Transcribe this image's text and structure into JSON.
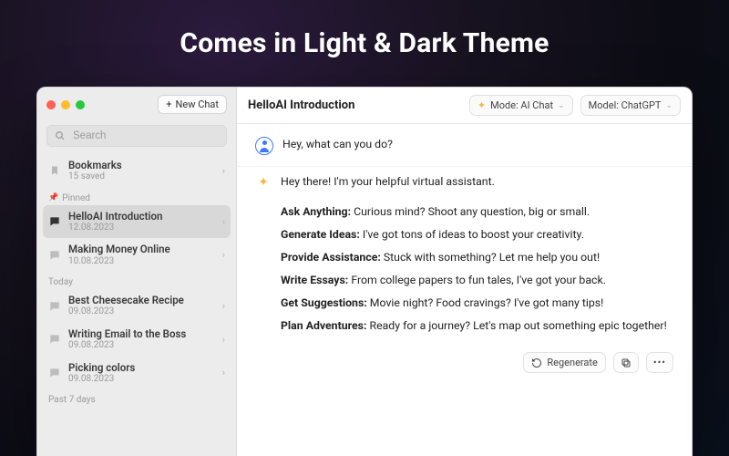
{
  "hero": {
    "headline": "Comes in Light & Dark Theme"
  },
  "sidebar": {
    "new_chat_label": "New Chat",
    "search_placeholder": "Search",
    "bookmarks": {
      "title": "Bookmarks",
      "subtitle": "15 saved"
    },
    "pinned_label": "Pinned",
    "today_label": "Today",
    "past7_label": "Past 7 days",
    "pinned": [
      {
        "title": "HelloAI Introduction",
        "date": "12.08.2023",
        "selected": true
      },
      {
        "title": "Making Money Online",
        "date": "10.08.2023",
        "selected": false
      }
    ],
    "today": [
      {
        "title": "Best Cheesecake Recipe",
        "date": "09.08.2023"
      },
      {
        "title": "Writing Email to the Boss",
        "date": "09.08.2023"
      },
      {
        "title": "Picking colors",
        "date": "09.08.2023"
      }
    ]
  },
  "toolbar": {
    "title": "HelloAI Introduction",
    "mode_label": "Mode: AI Chat",
    "model_label": "Model: ChatGPT"
  },
  "chat": {
    "user_message": "Hey, what can you do?",
    "ai_intro": "Hey there! I'm your helpful virtual assistant.",
    "features": [
      {
        "k": "Ask Anything:",
        "v": " Curious mind? Shoot any question, big or small."
      },
      {
        "k": "Generate Ideas:",
        "v": " I've got tons of ideas to boost your creativity."
      },
      {
        "k": "Provide Assistance:",
        "v": " Stuck with something? Let me help you out!"
      },
      {
        "k": "Write Essays:",
        "v": " From college papers to fun tales, I've got your back."
      },
      {
        "k": "Get Suggestions:",
        "v": " Movie night? Food cravings? I've got many tips!"
      },
      {
        "k": "Plan Adventures:",
        "v": " Ready for a journey? Let's map out something epic together!"
      }
    ],
    "regenerate_label": "Regenerate"
  }
}
